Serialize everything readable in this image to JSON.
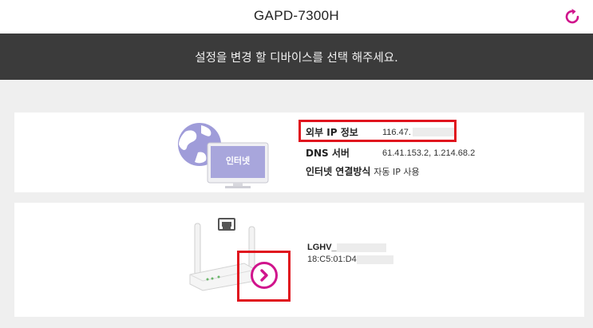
{
  "header": {
    "title": "GAPD-7300H",
    "refresh_icon": "refresh-icon",
    "accent_color": "#d0148c"
  },
  "banner": {
    "text": "설정을 변경 할 디바이스를 선택 해주세요."
  },
  "internet": {
    "monitor_label": "인터넷",
    "icon": "globe-monitor-icon",
    "rows": [
      {
        "label": "외부 IP 정보",
        "value": "116.47."
      },
      {
        "label": "DNS 서버",
        "value": "61.41.153.2, 1.214.68.2"
      },
      {
        "label": "인터넷 연결방식",
        "value": "자동 IP 사용"
      }
    ]
  },
  "device": {
    "icon": "router-icon",
    "name": "LGHV_",
    "mac": "18:C5:01:D4",
    "action_icon": "chevron-right-circle-icon"
  },
  "highlight_color": "#e0141e"
}
